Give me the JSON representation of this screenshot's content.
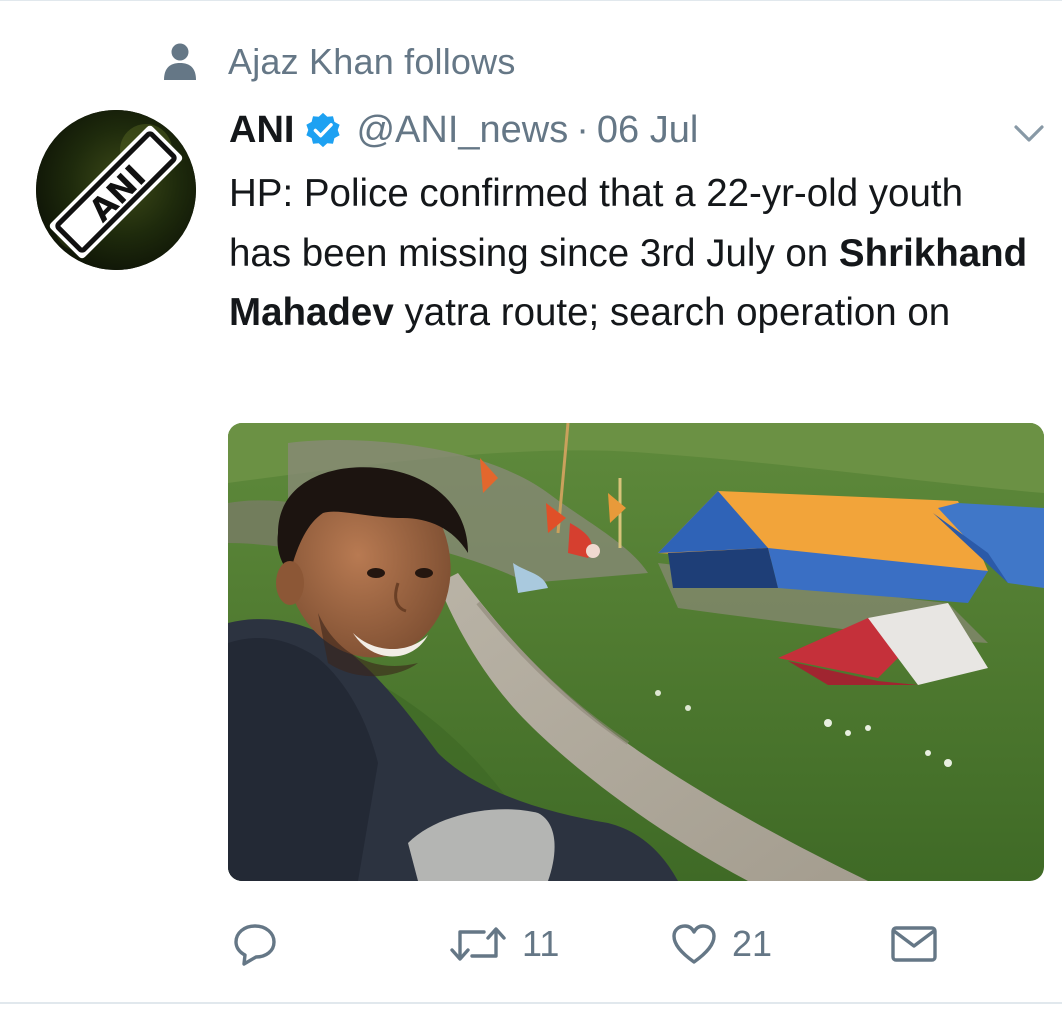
{
  "social_context": {
    "text": "Ajaz Khan follows",
    "icon": "person-icon"
  },
  "tweet": {
    "author_name": "ANI",
    "verified": true,
    "handle": "@ANI_news",
    "separator": "·",
    "date": "06 Jul",
    "avatar_logo_text": "ANI",
    "text_part_1": "HP: Police confirmed that a 22-yr-old youth has been missing since 3rd July on ",
    "text_bold": "Shrikhand Mahadev",
    "text_part_2": " yatra route; search operation on",
    "media": {
      "type": "photo",
      "subject": "Young man smiling in foreground, mountain trail with tents in background"
    },
    "actions": {
      "reply_icon": "reply-icon",
      "retweet_icon": "retweet-icon",
      "retweet_count": "11",
      "like_icon": "heart-icon",
      "like_count": "21",
      "message_icon": "envelope-icon"
    }
  },
  "colors": {
    "primary_text": "#14171a",
    "secondary_text": "#657786",
    "verified_blue": "#1da1f2",
    "divider": "#e1e8ed"
  }
}
